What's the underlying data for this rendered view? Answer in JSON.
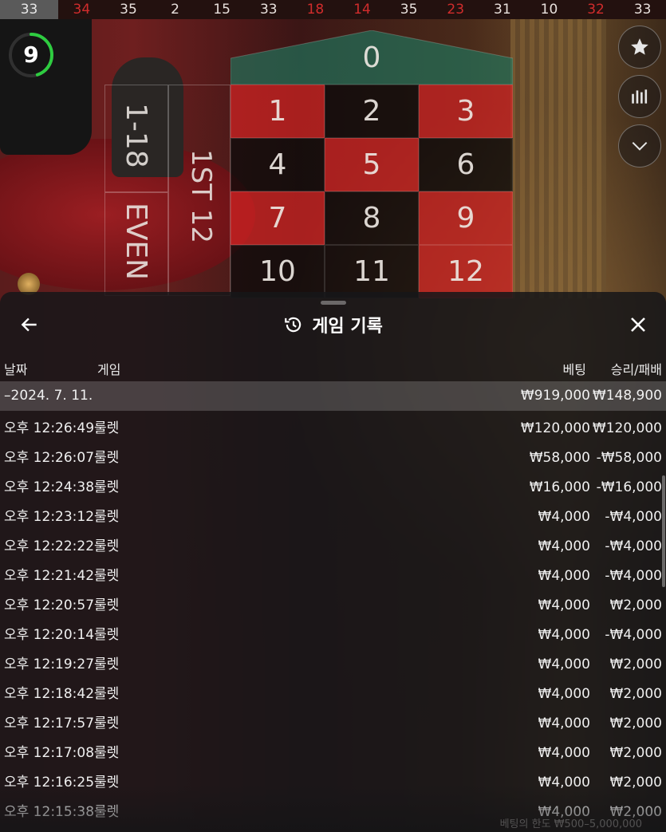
{
  "history_strip": [
    {
      "n": "33",
      "color": "gray"
    },
    {
      "n": "34",
      "color": "red"
    },
    {
      "n": "35",
      "color": "black"
    },
    {
      "n": "2",
      "color": "black"
    },
    {
      "n": "15",
      "color": "black"
    },
    {
      "n": "33",
      "color": "black"
    },
    {
      "n": "18",
      "color": "red"
    },
    {
      "n": "14",
      "color": "red"
    },
    {
      "n": "35",
      "color": "black"
    },
    {
      "n": "23",
      "color": "red"
    },
    {
      "n": "31",
      "color": "black"
    },
    {
      "n": "10",
      "color": "black"
    },
    {
      "n": "32",
      "color": "red"
    },
    {
      "n": "33",
      "color": "black"
    }
  ],
  "timer": {
    "value": "9",
    "progress": 0.45,
    "color": "#2ecc40"
  },
  "right_buttons": [
    "star-icon",
    "stats-icon",
    "chevron-down-icon"
  ],
  "board": {
    "zero": "0",
    "numbers": [
      {
        "n": "1",
        "color": "red"
      },
      {
        "n": "2",
        "color": "black"
      },
      {
        "n": "3",
        "color": "red"
      },
      {
        "n": "4",
        "color": "black"
      },
      {
        "n": "5",
        "color": "red"
      },
      {
        "n": "6",
        "color": "black"
      },
      {
        "n": "7",
        "color": "red"
      },
      {
        "n": "8",
        "color": "black"
      },
      {
        "n": "9",
        "color": "red"
      },
      {
        "n": "10",
        "color": "black"
      },
      {
        "n": "11",
        "color": "black"
      },
      {
        "n": "12",
        "color": "red"
      }
    ],
    "low_label": "1-18",
    "even_label": "EVEN",
    "dozen_label": "1ST 12"
  },
  "panel": {
    "title": "게임 기록",
    "columns": {
      "date": "날짜",
      "game": "게임",
      "bet": "베팅",
      "result": "승리/패배"
    },
    "date_row": {
      "date": "–2024. 7. 11.",
      "bet": "₩919,000",
      "result": "₩148,900"
    },
    "rows": [
      {
        "time": "오후 12:26:49",
        "game": "룰렛",
        "bet": "₩120,000",
        "result": "₩120,000"
      },
      {
        "time": "오후 12:26:07",
        "game": "룰렛",
        "bet": "₩58,000",
        "result": "-₩58,000"
      },
      {
        "time": "오후 12:24:38",
        "game": "룰렛",
        "bet": "₩16,000",
        "result": "-₩16,000"
      },
      {
        "time": "오후 12:23:12",
        "game": "룰렛",
        "bet": "₩4,000",
        "result": "-₩4,000"
      },
      {
        "time": "오후 12:22:22",
        "game": "룰렛",
        "bet": "₩4,000",
        "result": "-₩4,000"
      },
      {
        "time": "오후 12:21:42",
        "game": "룰렛",
        "bet": "₩4,000",
        "result": "-₩4,000"
      },
      {
        "time": "오후 12:20:57",
        "game": "룰렛",
        "bet": "₩4,000",
        "result": "₩2,000"
      },
      {
        "time": "오후 12:20:14",
        "game": "룰렛",
        "bet": "₩4,000",
        "result": "-₩4,000"
      },
      {
        "time": "오후 12:19:27",
        "game": "룰렛",
        "bet": "₩4,000",
        "result": "₩2,000"
      },
      {
        "time": "오후 12:18:42",
        "game": "룰렛",
        "bet": "₩4,000",
        "result": "₩2,000"
      },
      {
        "time": "오후 12:17:57",
        "game": "룰렛",
        "bet": "₩4,000",
        "result": "₩2,000"
      },
      {
        "time": "오후 12:17:08",
        "game": "룰렛",
        "bet": "₩4,000",
        "result": "₩2,000"
      },
      {
        "time": "오후 12:16:25",
        "game": "룰렛",
        "bet": "₩4,000",
        "result": "₩2,000"
      },
      {
        "time": "오후 12:15:38",
        "game": "룰렛",
        "bet": "₩4,000",
        "result": "₩2,000"
      }
    ],
    "footer_limits": "베팅의 한도 ₩500–5,000,000"
  }
}
